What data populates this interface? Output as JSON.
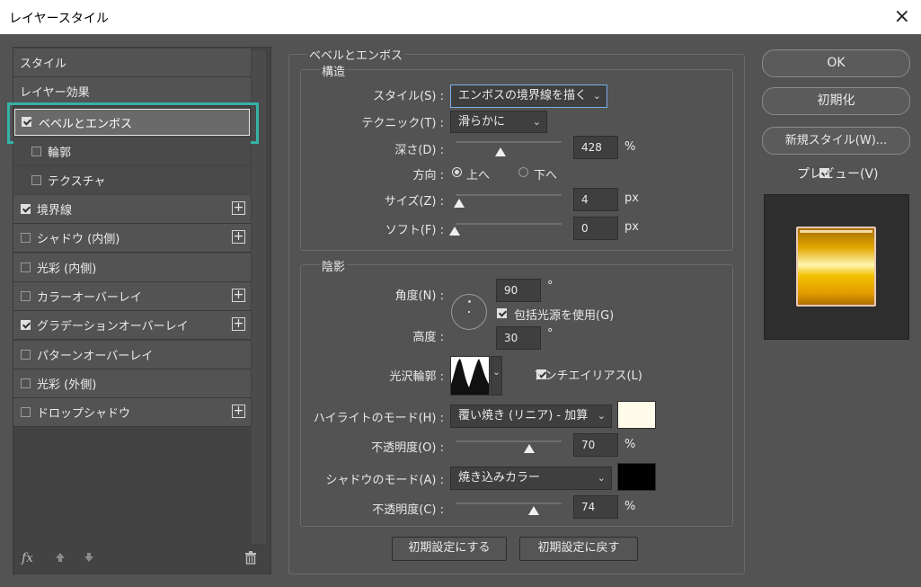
{
  "window": {
    "title": "レイヤースタイル",
    "close_icon": "×"
  },
  "left": {
    "items": [
      {
        "label": "スタイル"
      },
      {
        "label": "レイヤー効果"
      },
      {
        "label": "ベベルとエンボス",
        "checked": true
      },
      {
        "label": "輪郭",
        "checked": false
      },
      {
        "label": "テクスチャ",
        "checked": false
      },
      {
        "label": "境界線",
        "checked": true
      },
      {
        "label": "シャドウ (内側)",
        "checked": false
      },
      {
        "label": "光彩 (内側)",
        "checked": false
      },
      {
        "label": "カラーオーバーレイ",
        "checked": false
      },
      {
        "label": "グラデーションオーバーレイ",
        "checked": true
      },
      {
        "label": "パターンオーバーレイ",
        "checked": false
      },
      {
        "label": "光彩 (外側)",
        "checked": false
      },
      {
        "label": "ドロップシャドウ",
        "checked": false
      }
    ],
    "fx_label": "fx"
  },
  "bevel": {
    "section_title": "ベベルとエンボス",
    "structure_title": "構造",
    "style_label": "スタイル(S) :",
    "style_value": "エンボスの境界線を描く",
    "technique_label": "テクニック(T) :",
    "technique_value": "滑らかに",
    "depth_label": "深さ(D) :",
    "depth_value": "428",
    "depth_unit": "%",
    "direction_label": "方向 :",
    "direction_up": "上へ",
    "direction_down": "下へ",
    "size_label": "サイズ(Z) :",
    "size_value": "4",
    "size_unit": "px",
    "soften_label": "ソフト(F) :",
    "soften_value": "0",
    "soften_unit": "px"
  },
  "shading": {
    "title": "陰影",
    "angle_label": "角度(N) :",
    "angle_value": "90",
    "angle_unit": "°",
    "global_light_label": "包括光源を使用(G)",
    "altitude_label": "高度 :",
    "altitude_value": "30",
    "altitude_unit": "°",
    "gloss_label": "光沢輪郭 :",
    "antialias_label": "アンチエイリアス(L)",
    "highlight_mode_label": "ハイライトのモード(H) :",
    "highlight_mode_value": "覆い焼き (リニア) - 加算",
    "highlight_color": "#fffbea",
    "highlight_opacity_label": "不透明度(O) :",
    "highlight_opacity_value": "70",
    "highlight_opacity_unit": "%",
    "shadow_mode_label": "シャドウのモード(A) :",
    "shadow_mode_value": "焼き込みカラー",
    "shadow_color": "#000000",
    "shadow_opacity_label": "不透明度(C) :",
    "shadow_opacity_value": "74",
    "shadow_opacity_unit": "%"
  },
  "footer": {
    "make_default": "初期設定にする",
    "reset_default": "初期設定に戻す"
  },
  "right": {
    "ok": "OK",
    "reset": "初期化",
    "new_style": "新規スタイル(W)...",
    "preview_label": "プレビュー(V)"
  }
}
